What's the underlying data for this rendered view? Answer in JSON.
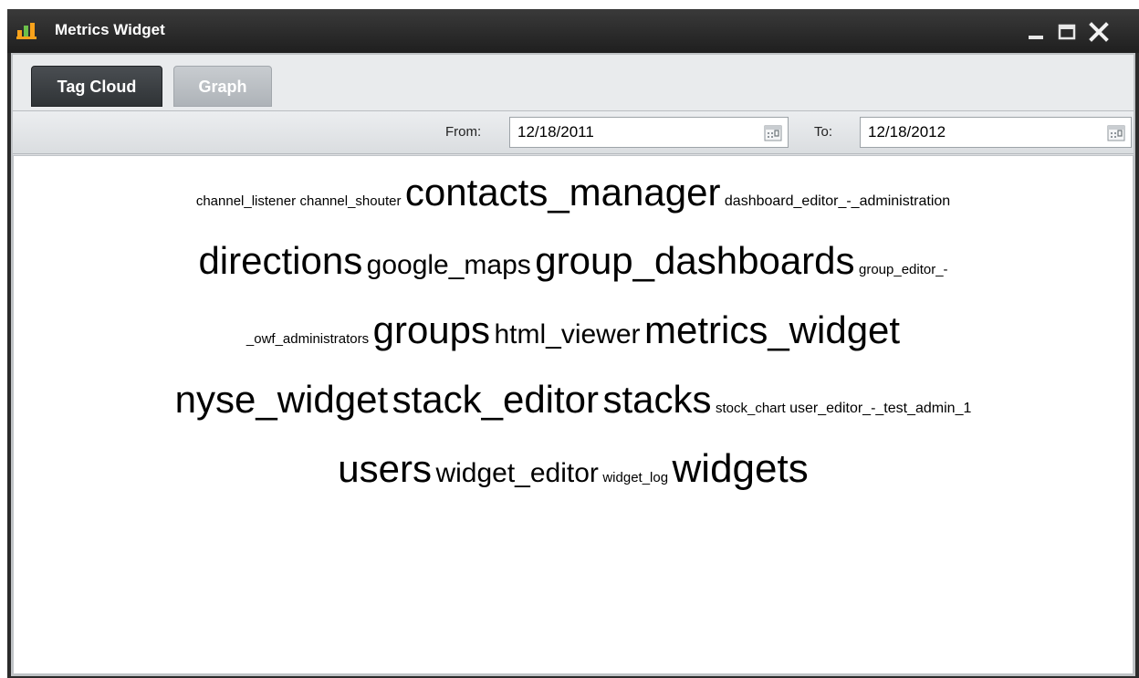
{
  "window": {
    "title": "Metrics Widget",
    "icon": "bar-chart-icon",
    "controls": [
      "minimize-icon",
      "maximize-icon",
      "close-icon"
    ]
  },
  "tabs": [
    {
      "label": "Tag Cloud",
      "active": true
    },
    {
      "label": "Graph",
      "active": false
    }
  ],
  "toolbar": {
    "from_label": "From:",
    "from_value": "12/18/2011",
    "to_label": "To:",
    "to_value": "12/18/2012",
    "calendar_icon": "calendar-icon"
  },
  "tag_cloud": {
    "lines": [
      [
        {
          "text": "channel_listener",
          "weight": 1
        },
        {
          "text": "channel_shouter",
          "weight": 1
        },
        {
          "text": "contacts_manager",
          "weight": 4
        },
        {
          "text": "dashboard_editor_-_administration",
          "weight": 2
        }
      ],
      [
        {
          "text": "directions",
          "weight": 4
        },
        {
          "text": "google_maps",
          "weight": 3
        },
        {
          "text": "group_dashboards",
          "weight": 4
        },
        {
          "text": "group_editor_-",
          "weight": 1
        }
      ],
      [
        {
          "text": "_owf_administrators",
          "weight": 1
        },
        {
          "text": "groups",
          "weight": 4
        },
        {
          "text": "html_viewer",
          "weight": 3
        },
        {
          "text": "metrics_widget",
          "weight": 4
        }
      ],
      [
        {
          "text": "nyse_widget",
          "weight": 4
        },
        {
          "text": "stack_editor",
          "weight": 4
        },
        {
          "text": "stacks",
          "weight": 4
        },
        {
          "text": "stock_chart",
          "weight": 1
        },
        {
          "text": "user_editor_-_test_admin_1",
          "weight": 2
        }
      ],
      [
        {
          "text": "users",
          "weight": 4
        },
        {
          "text": "widget_editor",
          "weight": 3
        },
        {
          "text": "widget_log",
          "weight": 1
        },
        {
          "text": "widgets",
          "weight": 5
        }
      ]
    ]
  },
  "colors": {
    "titlebar": "#2b2b2b",
    "tab_active": "#3a3e42",
    "tab_inactive": "#b8bcc0",
    "icon_orange": "#f7a21b",
    "icon_green": "#6cc04a"
  }
}
